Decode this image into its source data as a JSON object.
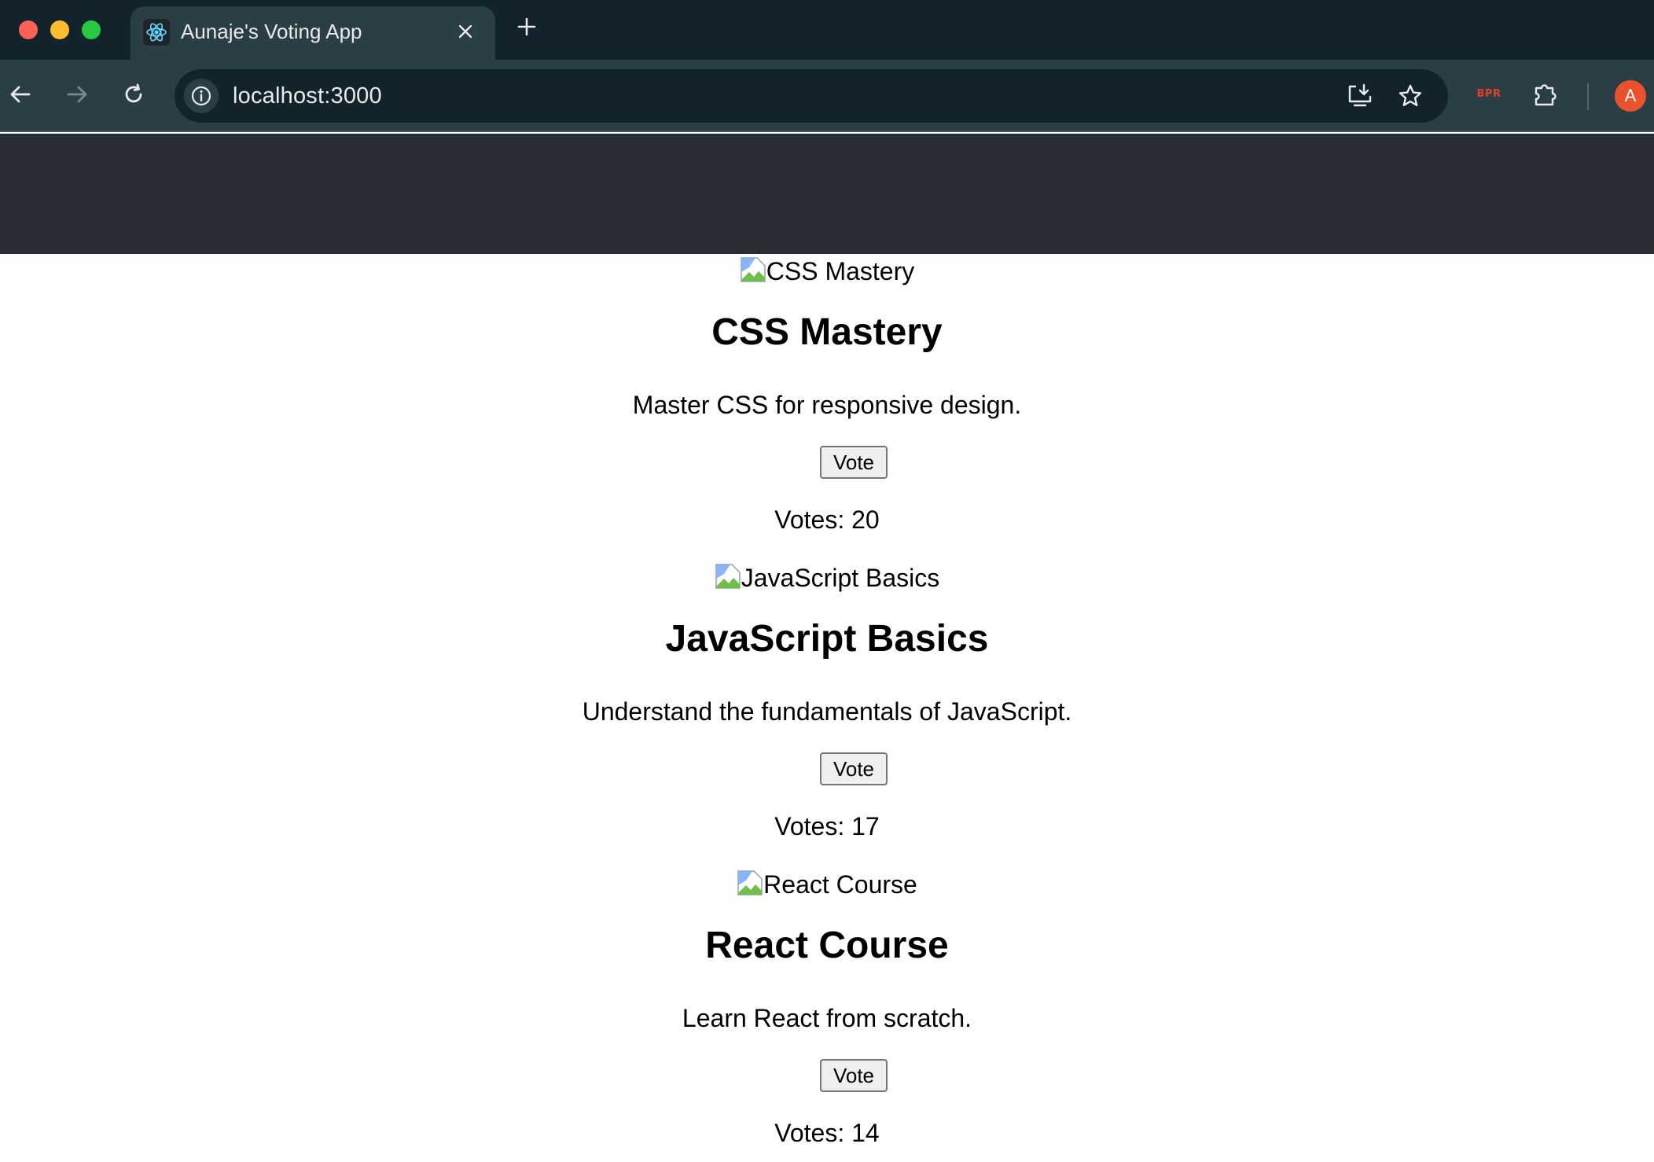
{
  "browser": {
    "tab_title": "Aunaje's Voting App",
    "url": "localhost:3000",
    "extension_badge": "BPR",
    "profile_initial": "A"
  },
  "icons": {
    "favicon": "react-atom-icon",
    "close": "close-icon",
    "new_tab": "plus-icon",
    "back": "arrow-left-icon",
    "forward": "arrow-right-icon",
    "reload": "reload-icon",
    "site_info": "info-icon",
    "install": "install-app-icon",
    "bookmark": "star-icon",
    "extensions": "puzzle-icon"
  },
  "colors": {
    "tabstrip": "#13232b",
    "toolbar": "#2c3e45",
    "app_header": "#282c34",
    "avatar": "#e8522f",
    "extension_badge": "#e0402a"
  },
  "courses": [
    {
      "image_alt": "CSS Mastery",
      "title": "CSS Mastery",
      "description": "Master CSS for responsive design.",
      "vote_label": "Vote",
      "votes_text": "Votes: 20"
    },
    {
      "image_alt": "JavaScript Basics",
      "title": "JavaScript Basics",
      "description": "Understand the fundamentals of JavaScript.",
      "vote_label": "Vote",
      "votes_text": "Votes: 17"
    },
    {
      "image_alt": "React Course",
      "title": "React Course",
      "description": "Learn React from scratch.",
      "vote_label": "Vote",
      "votes_text": "Votes: 14"
    }
  ]
}
